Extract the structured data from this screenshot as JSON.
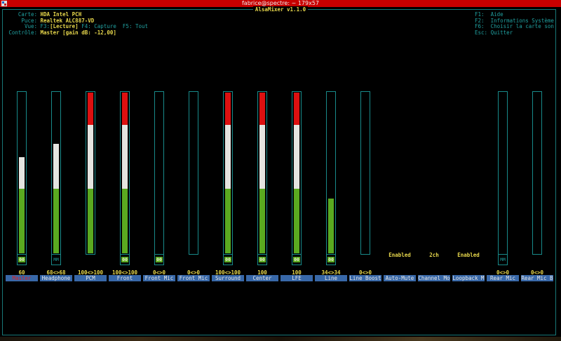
{
  "window": {
    "title": "fabrice@spectre: ~ 179x57"
  },
  "app": {
    "title": "AlsaMixer v1.1.0"
  },
  "info": {
    "card_label": "Carte:",
    "card": "HDA Intel PCH",
    "chip_label": "Puce:",
    "chip": "Realtek ALC887-VD",
    "view_label": "Vue:",
    "view_f3": "F3:",
    "view_playback": "[Lecture]",
    "view_f4": "F4: Capture",
    "view_f5": "F5: Tout",
    "control_label": "Contrôle:",
    "control": "Master [gain dB: -12,00]"
  },
  "help": [
    "F1:  Aide",
    "F2:  Informations Système",
    "F6:  Choisir la carte son",
    "Esc: Quitter"
  ],
  "colors": {
    "green": "#5aaa20",
    "white": "#e4e4e0",
    "red": "#dc1010"
  },
  "channels": [
    {
      "name": "Master",
      "value": "60",
      "level": 60,
      "mute": "00",
      "selected": true
    },
    {
      "name": "Headphone",
      "value": "68<>68",
      "level": 68,
      "mute": "MM"
    },
    {
      "name": "PCM",
      "value": "100<>100",
      "level": 100,
      "mute": null
    },
    {
      "name": "Front",
      "value": "100<>100",
      "level": 100,
      "mute": "00"
    },
    {
      "name": "Front Mic",
      "value": "0<>0",
      "level": 0,
      "mute": "00"
    },
    {
      "name": "Front Mic",
      "value": "0<>0",
      "level": 0,
      "mute": null
    },
    {
      "name": "Surround",
      "value": "100<>100",
      "level": 100,
      "mute": "00"
    },
    {
      "name": "Center",
      "value": "100",
      "level": 100,
      "mute": "00"
    },
    {
      "name": "LFE",
      "value": "100",
      "level": 100,
      "mute": "00"
    },
    {
      "name": "Line",
      "value": "34<>34",
      "level": 34,
      "mute": "00"
    },
    {
      "name": "Line Boost",
      "value": "0<>0",
      "level": 0,
      "mute": null
    },
    {
      "name": "Auto-Mute",
      "enum": "Enabled"
    },
    {
      "name": "Channel Mo",
      "enum": "2ch"
    },
    {
      "name": "Loopback M",
      "enum": "Enabled"
    },
    {
      "name": "Rear Mic",
      "value": "0<>0",
      "level": 0,
      "mute": "MM"
    },
    {
      "name": "Rear Mic B",
      "value": "0<>0",
      "level": 0,
      "mute": null
    }
  ]
}
